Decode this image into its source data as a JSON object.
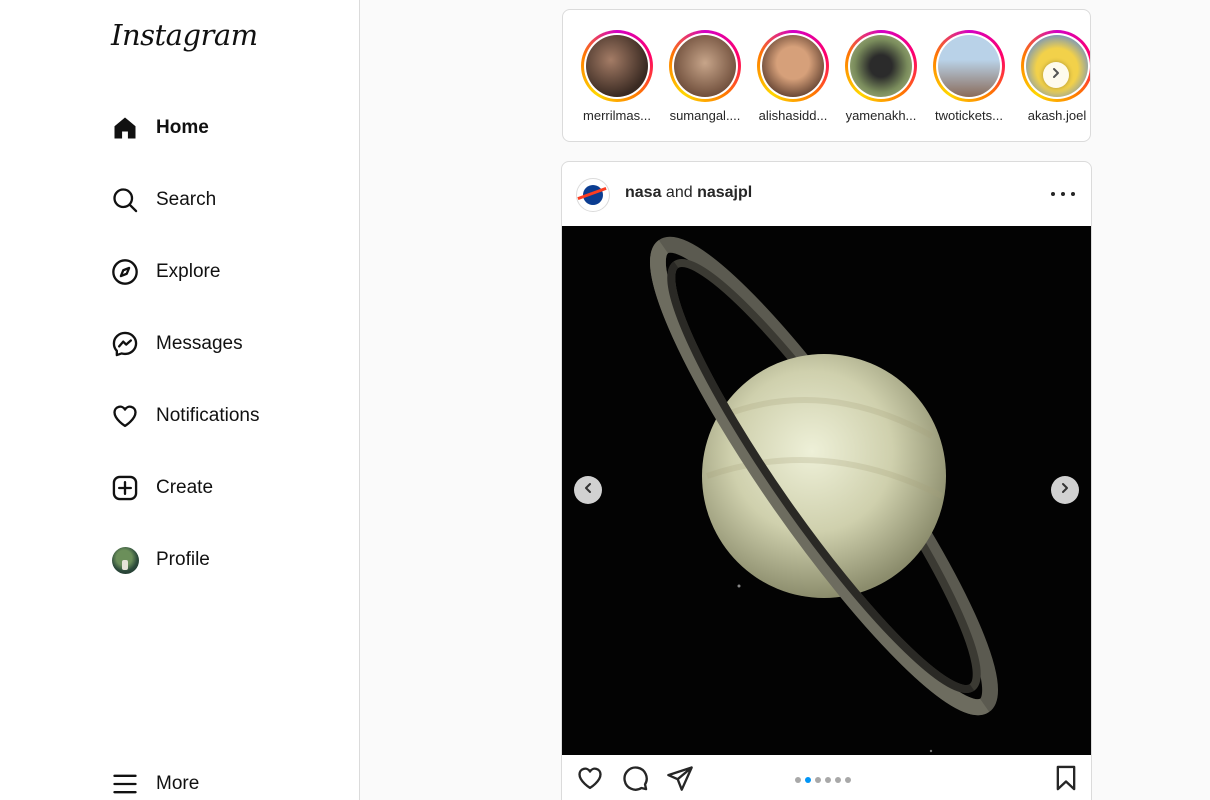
{
  "app": {
    "logo": "Instagram"
  },
  "sidebar": {
    "items": [
      {
        "label": "Home",
        "icon": "home-icon",
        "active": true
      },
      {
        "label": "Search",
        "icon": "search-icon"
      },
      {
        "label": "Explore",
        "icon": "compass-icon"
      },
      {
        "label": "Messages",
        "icon": "messenger-icon"
      },
      {
        "label": "Notifications",
        "icon": "heart-icon"
      },
      {
        "label": "Create",
        "icon": "plus-square-icon"
      },
      {
        "label": "Profile",
        "icon": "avatar"
      }
    ],
    "more": {
      "label": "More",
      "icon": "menu-icon"
    }
  },
  "stories": [
    {
      "name": "merrilmas...",
      "colors": [
        "#3a2a22",
        "#a47c66"
      ]
    },
    {
      "name": "sumangal....",
      "colors": [
        "#c7a58a",
        "#6e4d3a"
      ]
    },
    {
      "name": "alishasidd...",
      "colors": [
        "#d6a07a",
        "#5a3b2c"
      ]
    },
    {
      "name": "yamenakh...",
      "colors": [
        "#7a8c5c",
        "#2b2b2b"
      ]
    },
    {
      "name": "twotickets...",
      "colors": [
        "#b9d2e8",
        "#8a6b5a"
      ]
    },
    {
      "name": "akash.joel",
      "colors": [
        "#f2d14a",
        "#6a8fc7"
      ]
    }
  ],
  "post": {
    "user1": "nasa",
    "joiner": "and",
    "user2": "nasajpl",
    "carousel": {
      "count": 6,
      "current_index": 1
    }
  },
  "colors": {
    "accent": "#0095f6",
    "border": "#dbdbdb"
  }
}
